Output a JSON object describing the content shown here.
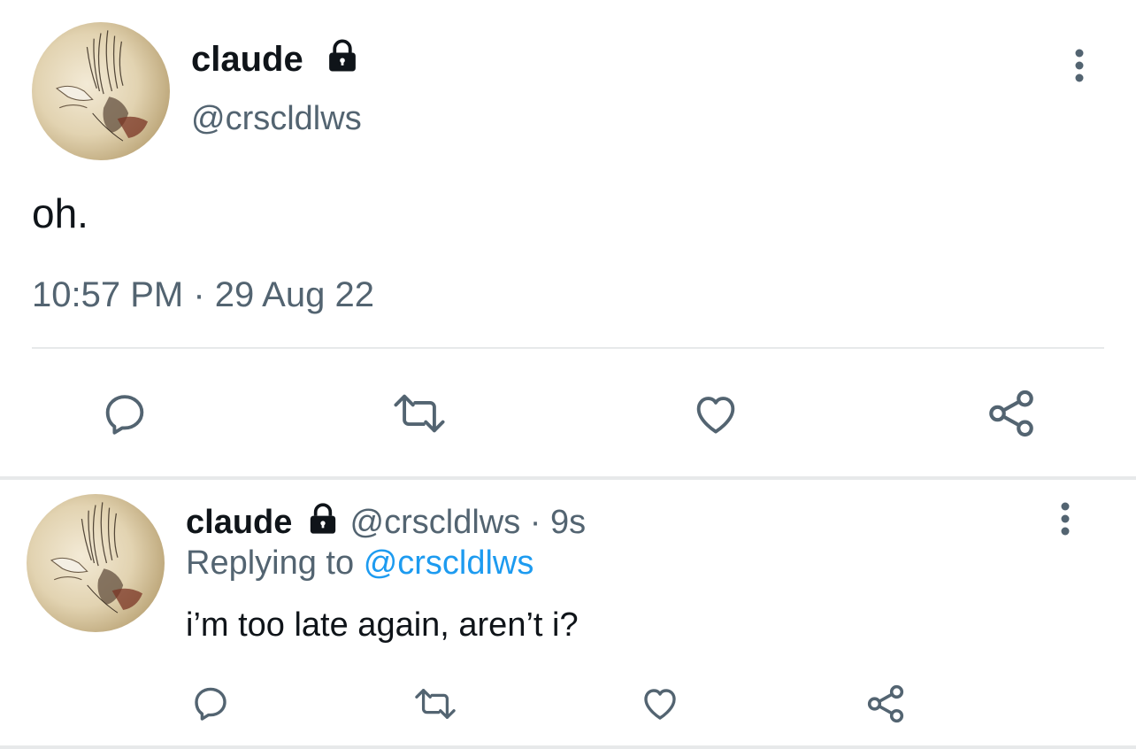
{
  "main_tweet": {
    "display_name": "claude",
    "handle": "@crscldlws",
    "text": "oh.",
    "timestamp": "10:57 PM · 29 Aug 22",
    "protected_icon": "lock-icon",
    "actions": [
      "reply-icon",
      "retweet-icon",
      "like-icon",
      "share-icon"
    ]
  },
  "reply_tweet": {
    "display_name": "claude",
    "handle": "@crscldlws",
    "separator": "·",
    "time_ago": "9s",
    "replying_prefix": "Replying to",
    "replying_to": "@crscldlws",
    "text": "i’m too late again, aren’t i?",
    "protected_icon": "lock-icon",
    "actions": [
      "reply-icon",
      "retweet-icon",
      "like-icon",
      "share-icon"
    ]
  },
  "colors": {
    "text": "#0f1419",
    "secondary": "#536471",
    "link": "#1d9bf0",
    "divider": "#e7e9ea"
  }
}
